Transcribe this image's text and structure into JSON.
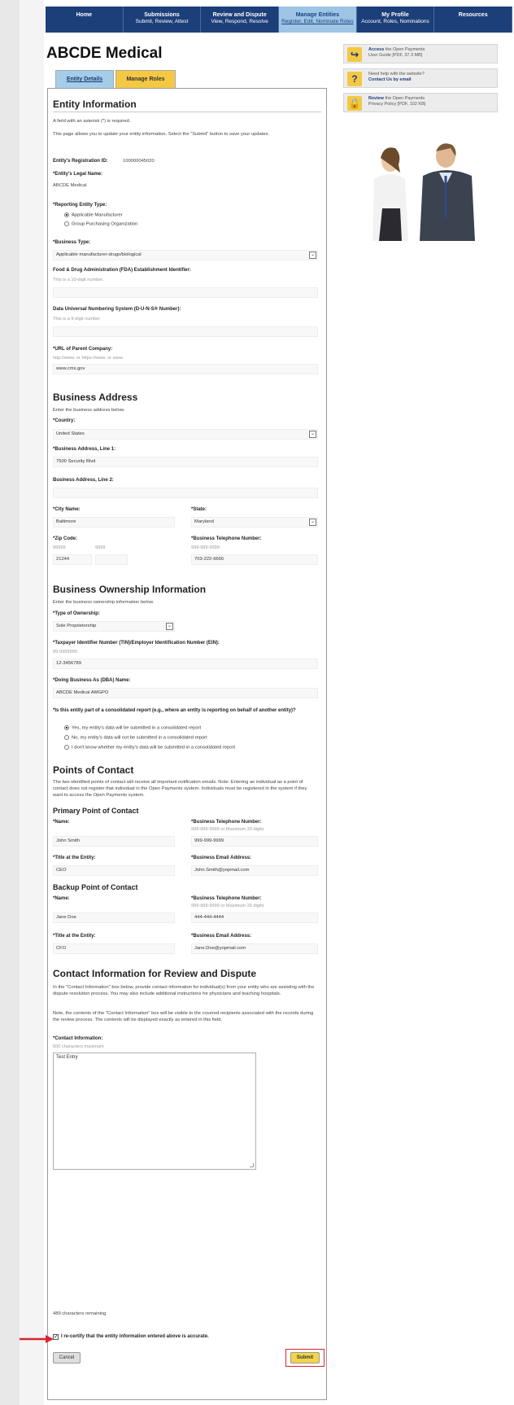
{
  "nav": [
    {
      "title": "Home",
      "sub": ""
    },
    {
      "title": "Submissions",
      "sub": "Submit, Review, Attest"
    },
    {
      "title": "Review and Dispute",
      "sub": "View, Respond, Resolve"
    },
    {
      "title": "Manage Entities",
      "sub": "Register, Edit, Nominate Roles"
    },
    {
      "title": "My Profile",
      "sub": "Account, Roles, Nominations"
    },
    {
      "title": "Resources",
      "sub": ""
    }
  ],
  "page_title": "ABCDE Medical",
  "tabs": {
    "entity_details": "Entity Details",
    "manage_roles": "Manage Roles"
  },
  "entity_info": {
    "heading": "Entity Information",
    "required_note": "A field with an asterisk (*) is required.",
    "intro": "This page allows you to update your entity information. Select the \"Submit\" button to save your updates.",
    "reg_id_label": "Entity's Registration ID:",
    "reg_id_value": "100000045020",
    "legal_name_label": "*Entity's Legal Name:",
    "legal_name_value": "ABCDE Medical",
    "reporting_type_label": "*Reporting Entity Type:",
    "reporting_type_options": [
      "Applicable Manufacturer",
      "Group Purchasing Organization"
    ],
    "business_type_label": "*Business Type:",
    "business_type_value": "Applicable manufacturer-drugs/biological",
    "fda_label": "Food & Drug Administration (FDA) Establishment Identifier:",
    "fda_hint": "This is a 10-digit number.",
    "duns_label": "Data Universal Numbering System (D-U-N-S® Number):",
    "duns_hint": "This is a 9-digit number",
    "url_label": "*URL of Parent Company:",
    "url_hint": "http://www. or https://www. or www.",
    "url_value": "www.cms.gov"
  },
  "address": {
    "heading": "Business Address",
    "intro": "Enter the business address below.",
    "country_label": "*Country:",
    "country_value": "United States",
    "line1_label": "*Business Address, Line 1:",
    "line1_value": "7500 Security Blvd",
    "line2_label": "Business Address, Line 2:",
    "city_label": "*City Name:",
    "city_value": "Baltimore",
    "state_label": "*State:",
    "state_value": "Maryland",
    "zip_label": "*Zip Code:",
    "zip_hint_1": "99999",
    "zip_hint_2": "9999",
    "zip_value": "21244",
    "phone_label": "*Business Telephone Number:",
    "phone_hint": "999-999-9999",
    "phone_value": "703-222-6666"
  },
  "ownership": {
    "heading": "Business Ownership Information",
    "intro": "Enter the business ownership information below.",
    "type_label": "*Type of Ownership:",
    "type_value": "Sole Proprietorship",
    "tin_label": "*Taxpayer Identifier Number (TIN)/Employer Identification Number (EIN):",
    "tin_hint": "99-9999999",
    "tin_value": "12-3456789",
    "dba_label": "*Doing Business As (DBA) Name:",
    "dba_value": "ABCDE Medical AMGPO",
    "consolidated_q": "*Is this entity part of a consolidated report (e.g., where an entity is reporting on behalf of another entity)?",
    "consolidated_options": [
      "Yes, my entity's data will be submitted in a consolidated report",
      "No, my entity's data will not be submitted in a consolidated report",
      "I don't know whether my entity's data will be submitted in a consolidated report"
    ]
  },
  "contacts": {
    "heading": "Points of Contact",
    "intro": "The two identified points of contact will receive all important notification emails. Note: Entering an individual as a point of contact does not register that individual in the Open Payments system. Individuals must be registered in the system if they want to access the Open Payments system.",
    "primary_heading": "Primary Point of Contact",
    "backup_heading": "Backup Point of Contact",
    "name_label": "*Name:",
    "phone_label": "*Business Telephone Number:",
    "phone_hint": "999-999-9999 or Maximum 20 digits",
    "title_label": "*Title at the Entity:",
    "email_label": "*Business Email Address:",
    "primary": {
      "name": "John Smith",
      "phone": "999-999-9999",
      "title": "CEO",
      "email": "John.Smith@yopmail.com"
    },
    "backup": {
      "name": "Jane Doe",
      "phone": "444-444-4444",
      "title": "CFO",
      "email": "Jane.Doe@yopmail.com"
    }
  },
  "review": {
    "heading": "Contact Information for Review and Dispute",
    "intro1": "In the \"Contact Information\" box below, provide contact information for individual(s) from your entity who are assisting with the dispute resolution process. You may also include additional instructions for physicians and teaching hospitals.",
    "intro2": "Note, the contents of the \"Contact Information\" box will be visible to the covered recipients associated with the records during the review process. The contents will be displayed exactly as entered in this field.",
    "ci_label": "*Contact Information:",
    "ci_hint": "500 characters maximum",
    "ci_value": "Test Entry",
    "remaining": "489 characters remaining",
    "recertify": "I re-certify that the entity information entered above is accurate.",
    "cancel": "Cancel",
    "submit": "Submit"
  },
  "sidebar": [
    {
      "icon": "external-link-icon",
      "glyph": "↪",
      "strong": "Access",
      "line1": " the Open Payments",
      "line2": "User Guide [PDF, 37.3 MB]"
    },
    {
      "icon": "question-icon",
      "glyph": "?",
      "strong": "",
      "line1": "Need help with the website?",
      "line2": "Contact Us by email"
    },
    {
      "icon": "lock-icon",
      "glyph": "🔒",
      "strong": "Review",
      "line1": " the Open Payments",
      "line2": "Privacy Policy [PDF, 102 KB]"
    }
  ],
  "colors": {
    "nav": "#1c3f7a",
    "active_nav": "#9ec4e6",
    "accent": "#f4c842",
    "red_highlight": "#d8272f"
  }
}
